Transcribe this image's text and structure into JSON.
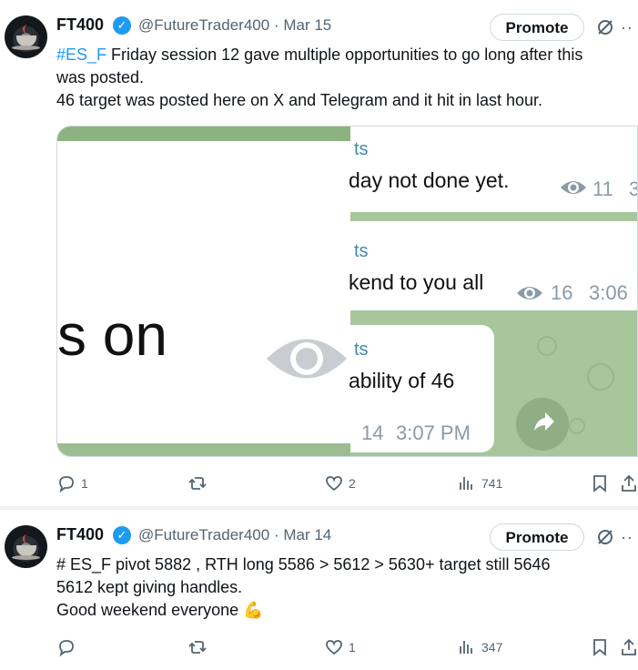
{
  "tweets": [
    {
      "author": {
        "name": "FT400",
        "handle": "@FutureTrader400",
        "date": "Mar 15"
      },
      "promote_label": "Promote",
      "hashtag": "#ES_F",
      "text_line1_rest": " Friday session 12 gave multiple opportunities to go long after this",
      "text_line2": "was posted.",
      "text_line3": "46 target was posted here on X and Telegram and it hit in last hour.",
      "media": {
        "left_zoom_text": "s on",
        "messages": [
          {
            "sender": "ts",
            "text": "day not done yet.",
            "views": "11",
            "extra": "3"
          },
          {
            "sender": "ts",
            "text": "kend to you all",
            "views": "16",
            "time": "3:06"
          },
          {
            "sender": "ts",
            "text": "ability of 46",
            "views": "14",
            "time": "3:07 PM"
          }
        ]
      },
      "stats": {
        "replies": "1",
        "reposts": "",
        "likes": "2",
        "views": "741"
      }
    },
    {
      "author": {
        "name": "FT400",
        "handle": "@FutureTrader400",
        "date": "Mar 14"
      },
      "promote_label": "Promote",
      "text_line1": "# ES_F pivot 5882 , RTH long 5586 > 5612 > 5630+ target still 5646",
      "text_line2": "5612 kept giving handles.",
      "text_line3": "Good weekend everyone",
      "emoji": "💪",
      "stats": {
        "replies": "",
        "reposts": "",
        "likes": "1",
        "views": "347"
      }
    }
  ],
  "colors": {
    "accent": "#1d9bf0",
    "muted": "#536471",
    "telegram_bg": "#a8c69c"
  }
}
